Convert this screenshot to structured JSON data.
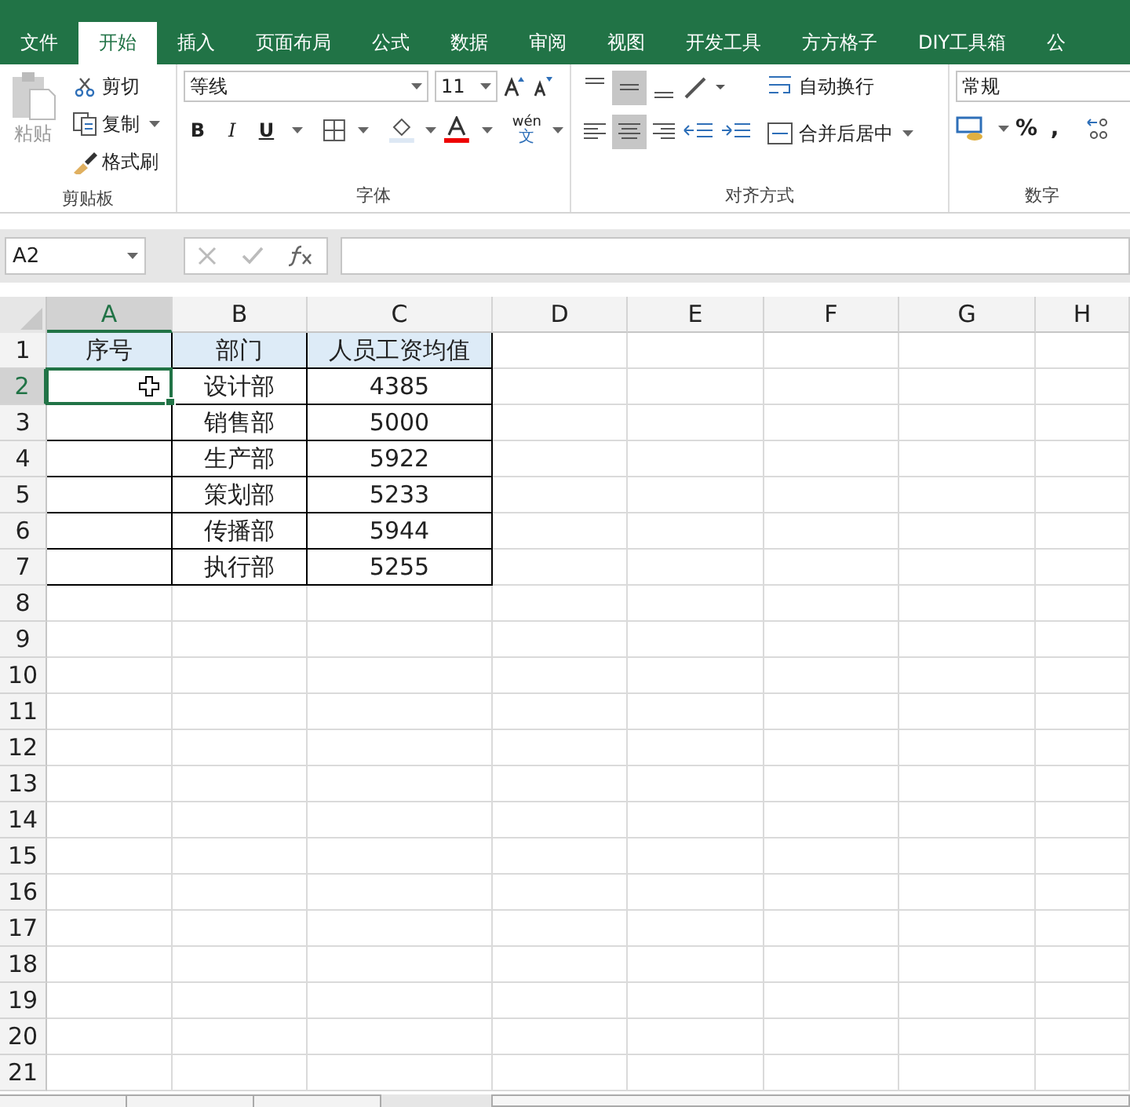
{
  "tabs": [
    {
      "label": "文件",
      "selected": false
    },
    {
      "label": "开始",
      "selected": true
    },
    {
      "label": "插入",
      "selected": false
    },
    {
      "label": "页面布局",
      "selected": false
    },
    {
      "label": "公式",
      "selected": false
    },
    {
      "label": "数据",
      "selected": false
    },
    {
      "label": "审阅",
      "selected": false
    },
    {
      "label": "视图",
      "selected": false
    },
    {
      "label": "开发工具",
      "selected": false
    },
    {
      "label": "方方格子",
      "selected": false
    },
    {
      "label": "DIY工具箱",
      "selected": false
    },
    {
      "label": "公",
      "selected": false
    }
  ],
  "clipboard": {
    "title": "剪贴板",
    "paste": "粘贴",
    "cut": "剪切",
    "copy": "复制",
    "format_painter": "格式刷"
  },
  "font": {
    "title": "字体",
    "font_name": "等线",
    "font_size": "11",
    "bold": "B",
    "italic": "I",
    "underline": "U",
    "phonetic_top": "wén",
    "phonetic_char": "文"
  },
  "alignment": {
    "title": "对齐方式",
    "wrap_text": "自动换行",
    "merge_center": "合并后居中"
  },
  "number": {
    "title": "数字",
    "format": "常规",
    "percent": "%",
    "comma": ","
  },
  "formula_bar": {
    "name_box": "A2"
  },
  "columns": [
    {
      "label": "A",
      "selected": true
    },
    {
      "label": "B",
      "selected": false
    },
    {
      "label": "C",
      "selected": false
    },
    {
      "label": "D",
      "selected": false
    },
    {
      "label": "E",
      "selected": false
    },
    {
      "label": "F",
      "selected": false
    },
    {
      "label": "G",
      "selected": false
    },
    {
      "label": "H",
      "selected": false
    }
  ],
  "rows": [
    {
      "label": "1",
      "selected": false,
      "cells": [
        "序号",
        "部门",
        "人员工资均值"
      ]
    },
    {
      "label": "2",
      "selected": true,
      "cells": [
        "",
        "设计部",
        "4385"
      ]
    },
    {
      "label": "3",
      "selected": false,
      "cells": [
        "",
        "销售部",
        "5000"
      ]
    },
    {
      "label": "4",
      "selected": false,
      "cells": [
        "",
        "生产部",
        "5922"
      ]
    },
    {
      "label": "5",
      "selected": false,
      "cells": [
        "",
        "策划部",
        "5233"
      ]
    },
    {
      "label": "6",
      "selected": false,
      "cells": [
        "",
        "传播部",
        "5944"
      ]
    },
    {
      "label": "7",
      "selected": false,
      "cells": [
        "",
        "执行部",
        "5255"
      ]
    },
    {
      "label": "8",
      "selected": false,
      "cells": []
    },
    {
      "label": "9",
      "selected": false,
      "cells": []
    },
    {
      "label": "10",
      "selected": false,
      "cells": []
    },
    {
      "label": "11",
      "selected": false,
      "cells": []
    },
    {
      "label": "12",
      "selected": false,
      "cells": []
    },
    {
      "label": "13",
      "selected": false,
      "cells": []
    },
    {
      "label": "14",
      "selected": false,
      "cells": []
    },
    {
      "label": "15",
      "selected": false,
      "cells": []
    },
    {
      "label": "16",
      "selected": false,
      "cells": []
    },
    {
      "label": "17",
      "selected": false,
      "cells": []
    },
    {
      "label": "18",
      "selected": false,
      "cells": []
    },
    {
      "label": "19",
      "selected": false,
      "cells": []
    },
    {
      "label": "20",
      "selected": false,
      "cells": []
    },
    {
      "label": "21",
      "selected": false,
      "cells": []
    }
  ]
}
